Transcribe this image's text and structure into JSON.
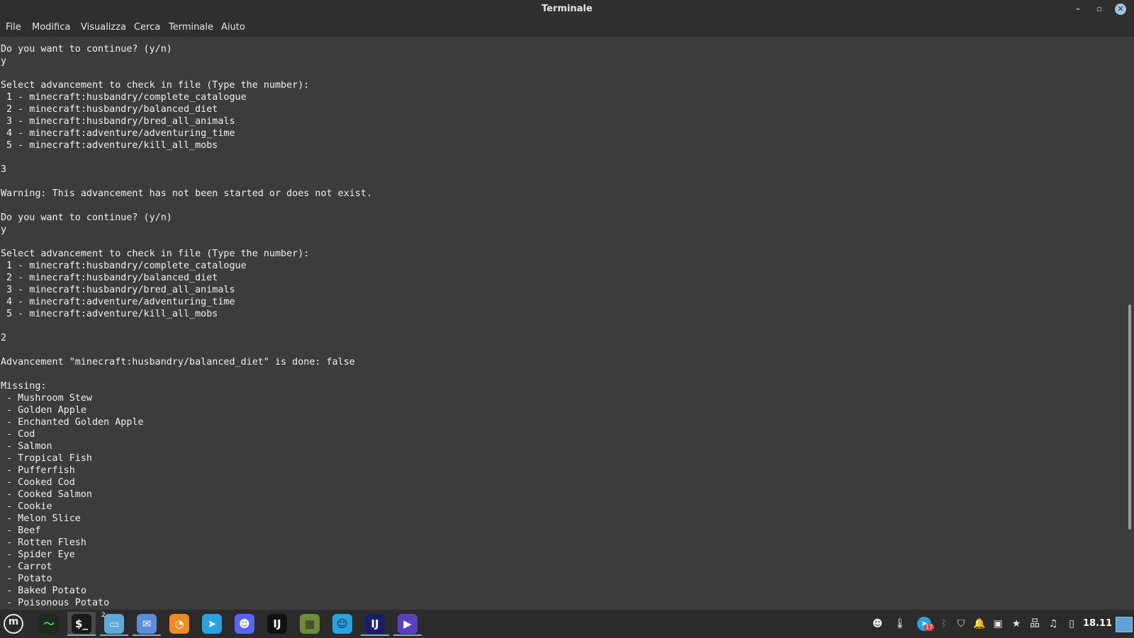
{
  "window": {
    "title": "Terminale",
    "controls": {
      "minimize": "–",
      "maximize": "▫",
      "close": "✕"
    }
  },
  "menu": [
    "File",
    "Modifica",
    "Visualizza",
    "Cerca",
    "Terminale",
    "Aiuto"
  ],
  "terminal": {
    "lines": [
      "Do you want to continue? (y/n)",
      "y",
      "",
      "Select advancement to check in file (Type the number):",
      " 1 - minecraft:husbandry/complete_catalogue",
      " 2 - minecraft:husbandry/balanced_diet",
      " 3 - minecraft:husbandry/bred_all_animals",
      " 4 - minecraft:adventure/adventuring_time",
      " 5 - minecraft:adventure/kill_all_mobs",
      "",
      "3",
      "",
      "Warning: This advancement has not been started or does not exist.",
      "",
      "Do you want to continue? (y/n)",
      "y",
      "",
      "Select advancement to check in file (Type the number):",
      " 1 - minecraft:husbandry/complete_catalogue",
      " 2 - minecraft:husbandry/balanced_diet",
      " 3 - minecraft:husbandry/bred_all_animals",
      " 4 - minecraft:adventure/adventuring_time",
      " 5 - minecraft:adventure/kill_all_mobs",
      "",
      "2",
      "",
      "Advancement \"minecraft:husbandry/balanced_diet\" is done: false",
      "",
      "Missing:",
      " - Mushroom Stew",
      " - Golden Apple",
      " - Enchanted Golden Apple",
      " - Cod",
      " - Salmon",
      " - Tropical Fish",
      " - Pufferfish",
      " - Cooked Cod",
      " - Cooked Salmon",
      " - Cookie",
      " - Melon Slice",
      " - Beef",
      " - Rotten Flesh",
      " - Spider Eye",
      " - Carrot",
      " - Potato",
      " - Baked Potato",
      " - Poisonous Potato"
    ]
  },
  "taskbar": {
    "menu_button": {
      "icon": "mint-logo-icon",
      "glyph": "m"
    },
    "apps": [
      {
        "name": "system-monitor",
        "icon": "system-monitor-icon",
        "glyph": "〜",
        "color": "#1e2a1e",
        "fg": "#4cd964",
        "active": false,
        "running": false
      },
      {
        "name": "terminal",
        "icon": "terminal-icon",
        "glyph": "$_",
        "color": "#1a1a1a",
        "fg": "#ffffff",
        "active": true,
        "running": true
      },
      {
        "name": "files",
        "icon": "folder-icon",
        "glyph": "▭",
        "color": "#5fa8d8",
        "fg": "#e8f4ff",
        "active": false,
        "running": true,
        "badge": "2"
      },
      {
        "name": "mail",
        "icon": "mail-icon",
        "glyph": "✉",
        "color": "#5b8ed6",
        "fg": "#ffffff",
        "active": false,
        "running": true
      },
      {
        "name": "firefox",
        "icon": "firefox-icon",
        "glyph": "◔",
        "color": "#f08a24",
        "fg": "#ffffff",
        "active": false,
        "running": false
      },
      {
        "name": "telegram",
        "icon": "telegram-icon",
        "glyph": "➤",
        "color": "#2aa3e0",
        "fg": "#ffffff",
        "active": false,
        "running": false
      },
      {
        "name": "discord",
        "icon": "discord-icon",
        "glyph": "☻",
        "color": "#5865f2",
        "fg": "#ffffff",
        "active": false,
        "running": false
      },
      {
        "name": "intellij-idea",
        "icon": "intellij-icon",
        "glyph": "IJ",
        "color": "#111111",
        "fg": "#ffffff",
        "active": false,
        "running": false
      },
      {
        "name": "minecraft",
        "icon": "minecraft-icon",
        "glyph": "▦",
        "color": "#6b8e3a",
        "fg": "#3a2a1a",
        "active": false,
        "running": false
      },
      {
        "name": "bitwarden",
        "icon": "shield-app-icon",
        "glyph": "☺",
        "color": "#2aa3e0",
        "fg": "#111111",
        "active": false,
        "running": false
      },
      {
        "name": "intellij-idea-2",
        "icon": "intellij-icon",
        "glyph": "IJ",
        "color": "#1c1c6e",
        "fg": "#ffffff",
        "active": false,
        "running": true
      },
      {
        "name": "media-player",
        "icon": "play-icon",
        "glyph": "▶",
        "color": "#5a3fbf",
        "fg": "#ffffff",
        "active": false,
        "running": true
      }
    ],
    "tray": [
      {
        "name": "discord-tray",
        "icon": "discord-icon",
        "glyph": "☻"
      },
      {
        "name": "temperature",
        "icon": "thermometer-icon",
        "glyph": "🌡"
      },
      {
        "name": "telegram-tray",
        "icon": "telegram-icon",
        "glyph": "➤"
      },
      {
        "name": "bluetooth",
        "icon": "bluetooth-icon",
        "glyph": "ᛒ"
      },
      {
        "name": "security",
        "icon": "shield-icon",
        "glyph": "⛉"
      },
      {
        "name": "notifications",
        "icon": "bell-icon",
        "glyph": "🔔"
      },
      {
        "name": "updates",
        "icon": "update-icon",
        "glyph": "▣"
      },
      {
        "name": "favorites",
        "icon": "star-icon",
        "glyph": "★"
      },
      {
        "name": "network",
        "icon": "network-icon",
        "glyph": "品"
      },
      {
        "name": "sound",
        "icon": "music-note-icon",
        "glyph": "♫"
      },
      {
        "name": "power",
        "icon": "battery-icon",
        "glyph": "▯"
      }
    ],
    "telegram_badge": "17",
    "clock": "18.11"
  },
  "colors": {
    "terminal_bg": "#3c3c3c",
    "terminal_fg": "#f0f0f0",
    "titlebar_bg": "#2f2f2f",
    "taskbar_bg": "#2b2b2b",
    "accent": "#7aa9d6"
  }
}
